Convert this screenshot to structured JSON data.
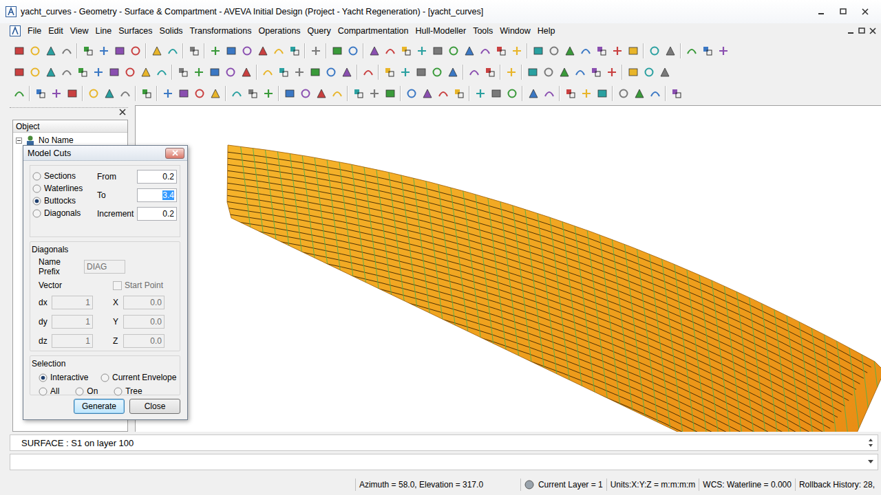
{
  "window": {
    "title": "yacht_curves - Geometry - Surface & Compartment - AVEVA Initial Design (Project - Yacht Regeneration) - [yacht_curves]"
  },
  "menu": [
    "File",
    "Edit",
    "View",
    "Line",
    "Surfaces",
    "Solids",
    "Transformations",
    "Operations",
    "Query",
    "Compartmentation",
    "Hull-Modeller",
    "Tools",
    "Window",
    "Help"
  ],
  "object_panel": {
    "header": "Object",
    "items": [
      {
        "label": "No Name",
        "expanded": true
      }
    ]
  },
  "dialog": {
    "title": "Model Cuts",
    "cut_types": [
      {
        "label": "Sections",
        "selected": false
      },
      {
        "label": "Waterlines",
        "selected": false
      },
      {
        "label": "Buttocks",
        "selected": true
      },
      {
        "label": "Diagonals",
        "selected": false
      }
    ],
    "fields": [
      {
        "label": "From",
        "value": "0.2",
        "selected": false
      },
      {
        "label": "To",
        "value": "3.4",
        "selected": true
      },
      {
        "label": "Increment",
        "value": "0.2",
        "selected": false
      }
    ],
    "diagonals": {
      "label": "Diagonals",
      "disabled": true,
      "name_prefix_label": "Name Prefix",
      "name_prefix": "DIAG",
      "vector_label": "Vector",
      "start_point": {
        "label": "Start Point",
        "checked": false,
        "disabled": true
      },
      "vector": [
        {
          "label": "dx",
          "value": "1"
        },
        {
          "label": "dy",
          "value": "1"
        },
        {
          "label": "dz",
          "value": "1"
        }
      ],
      "start": [
        {
          "label": "X",
          "value": "0.0"
        },
        {
          "label": "Y",
          "value": "0.0"
        },
        {
          "label": "Z",
          "value": "0.0"
        }
      ]
    },
    "selection": {
      "label": "Selection",
      "options": [
        {
          "label": "Interactive",
          "selected": true
        },
        {
          "label": "Current Envelope",
          "selected": false
        },
        {
          "label": "All",
          "selected": false
        },
        {
          "label": "On",
          "selected": false
        },
        {
          "label": "Tree",
          "selected": false
        }
      ]
    },
    "buttons": [
      {
        "label": "Generate",
        "default": true
      },
      {
        "label": "Close",
        "default": false
      }
    ]
  },
  "command": {
    "output": "SURFACE : S1 on layer 100",
    "input": ""
  },
  "status_bar": [
    "Azimuth = 58.0, Elevation = 317.0",
    "Current Layer = 1",
    "Units:X:Y:Z = m:m:m:m",
    "WCS: Waterline = 0.000",
    "Rollback History: 28,"
  ]
}
